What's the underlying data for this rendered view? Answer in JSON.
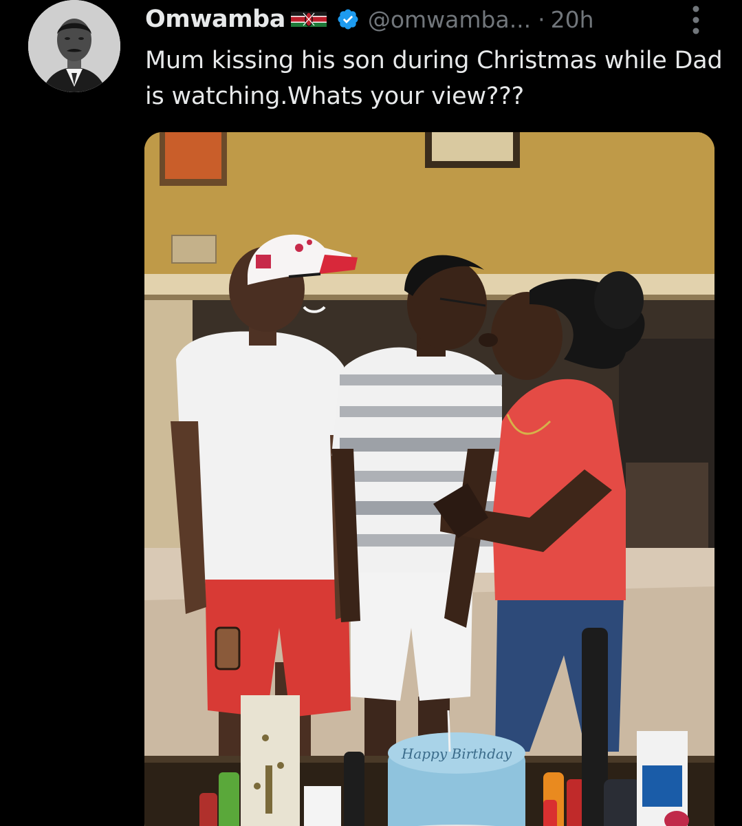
{
  "tweet": {
    "author": {
      "display_name": "Omwamba",
      "handle": "@omwamba...",
      "verified": true,
      "flag": "kenya-flag-icon",
      "avatar": "avatar-portrait"
    },
    "separator": "·",
    "timestamp": "20h",
    "text": "Mum kissing his son during Christmas while Dad is watching.Whats your view???",
    "media": {
      "type": "photo",
      "cake_text": "Happy Birthday"
    },
    "icons": {
      "more": "more-vertical-icon",
      "verified": "verified-badge-icon"
    },
    "colors": {
      "background": "#000000",
      "text": "#e7e9ea",
      "muted": "#71767b",
      "verified": "#1d9bf0"
    }
  }
}
